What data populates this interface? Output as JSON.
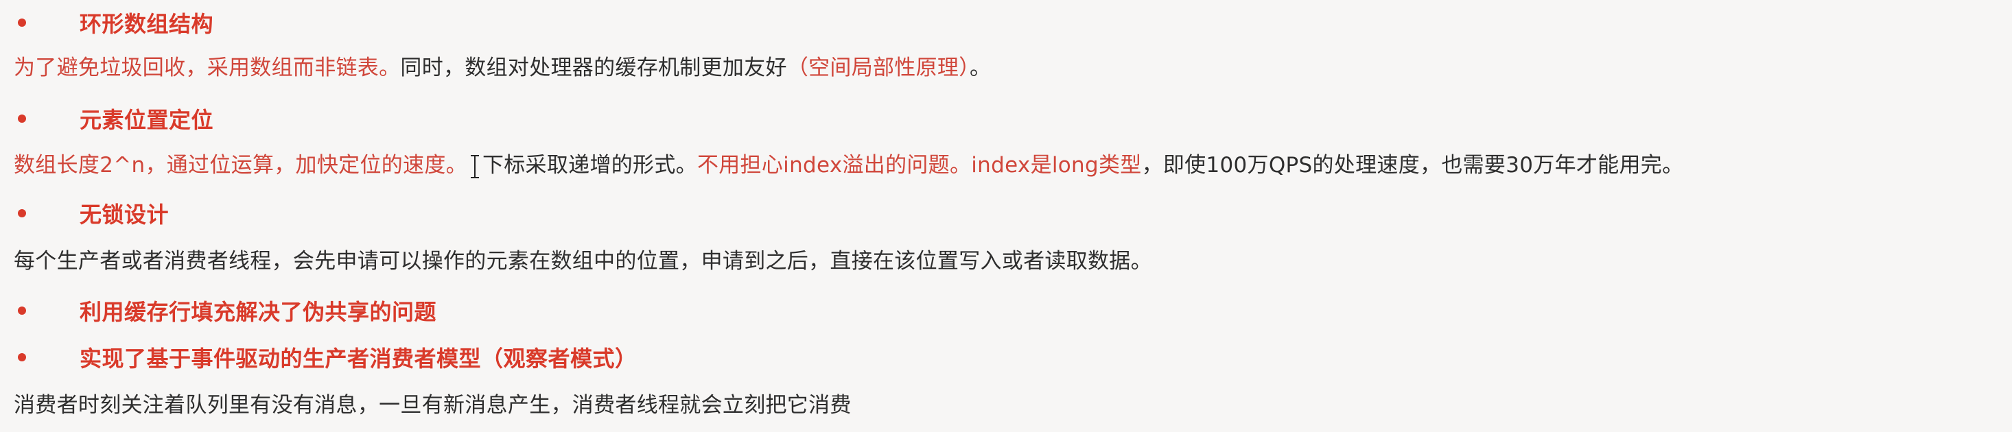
{
  "sections": [
    {
      "heading": "环形数组结构",
      "paragraph": [
        {
          "text": "为了避免垃圾回收，采用数组而非链表。",
          "style": "red"
        },
        {
          "text": "同时，数组对处理器的缓存机制更加友好",
          "style": "dark"
        },
        {
          "text": "（空间局部性原理）",
          "style": "red"
        },
        {
          "text": "。",
          "style": "dark"
        }
      ]
    },
    {
      "heading": "元素位置定位",
      "paragraph_a": [
        {
          "text": "数组长度2^n，通过位运算，加快定位的速度。",
          "style": "red"
        }
      ],
      "paragraph_b": [
        {
          "text": "下标采取递增的形式。",
          "style": "dark"
        },
        {
          "text": "不用担心index溢出的问题。index是long类型",
          "style": "red"
        },
        {
          "text": "，即使100万QPS的处理速度，也需要30万年才能用完。",
          "style": "dark"
        }
      ]
    },
    {
      "heading": "无锁设计",
      "paragraph": [
        {
          "text": "每个生产者或者消费者线程，会先申请可以操作的元素在数组中的位置，申请到之后，直接在该位置写入或者读取数据。",
          "style": "dark"
        }
      ]
    },
    {
      "heading": "利用缓存行填充解决了伪共享的问题"
    },
    {
      "heading": "实现了基于事件驱动的生产者消费者模型（观察者模式）",
      "paragraph": [
        {
          "text": "消费者时刻关注着队列里有没有消息，一旦有新消息产生，消费者线程就会立刻把它消费",
          "style": "dark"
        }
      ]
    }
  ]
}
